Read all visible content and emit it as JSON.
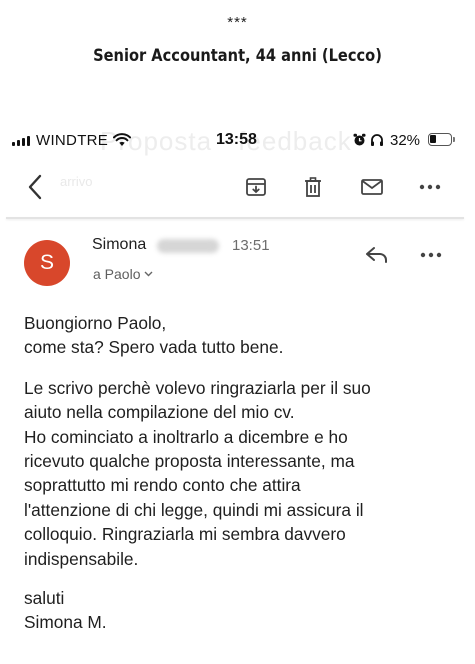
{
  "caption": {
    "stars": "***",
    "title": "Senior Accountant, 44 anni (Lecco)"
  },
  "statusbar": {
    "carrier": "WINDTRE",
    "time": "13:58",
    "battery": "32%",
    "battery_level": 0.32,
    "ghost_subject": "Proposta - feedback"
  },
  "toolbar": {
    "ghost_label": "arrivo",
    "icons": [
      "back-icon",
      "archive-icon",
      "trash-icon",
      "mail-icon",
      "more-icon"
    ]
  },
  "message": {
    "avatar_initial": "S",
    "avatar_color": "#d8472b",
    "sender": "Simona",
    "time": "13:51",
    "recipient": "a Paolo"
  },
  "body": {
    "greeting": [
      "Buongiorno Paolo,",
      "come sta? Spero vada tutto bene."
    ],
    "paragraph": [
      "Le scrivo perchè volevo ringraziarla per il suo",
      "aiuto nella compilazione del mio cv.",
      "Ho cominciato a inoltrarlo a dicembre e ho",
      "ricevuto qualche proposta interessante, ma",
      "soprattutto mi rendo conto che attira",
      "l'attenzione di chi legge, quindi mi assicura il",
      "colloquio. Ringraziarla mi sembra davvero",
      "indispensabile."
    ],
    "closing": [
      "saluti",
      "Simona M."
    ]
  }
}
